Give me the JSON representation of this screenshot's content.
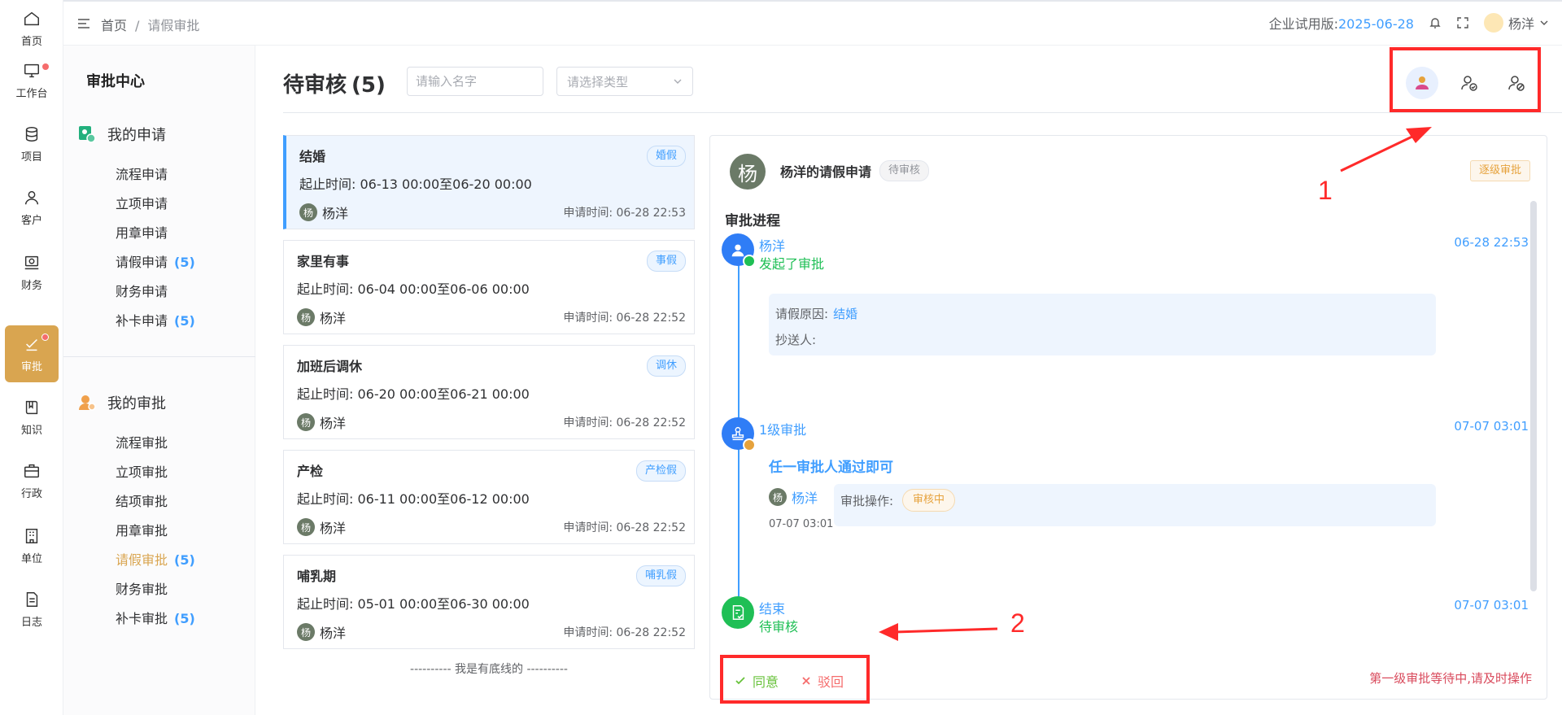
{
  "rail": {
    "items": [
      {
        "label": "首页",
        "icon": "home-icon"
      },
      {
        "label": "工作台",
        "icon": "monitor-icon",
        "dot": true
      },
      {
        "label": "项目",
        "icon": "database-icon"
      },
      {
        "label": "客户",
        "icon": "user-icon"
      },
      {
        "label": "财务",
        "icon": "finance-icon"
      },
      {
        "label": "审批",
        "icon": "approve-icon",
        "active": true,
        "dot": true
      },
      {
        "label": "知识",
        "icon": "book-icon"
      },
      {
        "label": "行政",
        "icon": "briefcase-icon"
      },
      {
        "label": "单位",
        "icon": "building-icon"
      },
      {
        "label": "日志",
        "icon": "log-icon"
      }
    ]
  },
  "header": {
    "breadcrumb": {
      "home": "首页",
      "sep": "/",
      "current": "请假审批"
    },
    "edition_label": "企业试用版:",
    "edition_date": "2025-06-28",
    "user_name": "杨洋"
  },
  "sidebar": {
    "title": "审批中心",
    "my_apply": {
      "title": "我的申请",
      "items": [
        {
          "label": "流程申请",
          "count": ""
        },
        {
          "label": "立项申请",
          "count": ""
        },
        {
          "label": "用章申请",
          "count": ""
        },
        {
          "label": "请假申请",
          "count": "(5)"
        },
        {
          "label": "财务申请",
          "count": ""
        },
        {
          "label": "补卡申请",
          "count": "(5)"
        }
      ]
    },
    "my_approve": {
      "title": "我的审批",
      "items": [
        {
          "label": "流程审批",
          "count": ""
        },
        {
          "label": "立项审批",
          "count": ""
        },
        {
          "label": "结项审批",
          "count": ""
        },
        {
          "label": "用章审批",
          "count": ""
        },
        {
          "label": "请假审批",
          "count": "(5)",
          "active": true
        },
        {
          "label": "财务审批",
          "count": ""
        },
        {
          "label": "补卡审批",
          "count": "(5)"
        }
      ]
    }
  },
  "main": {
    "title": "待审核",
    "count": "(5)",
    "search_placeholder": "请输入名字",
    "type_placeholder": "请选择类型",
    "colors": {
      "accent": "#409eff",
      "active_nav": "#d9a550",
      "annotation": "#ff2a2a"
    }
  },
  "cards": [
    {
      "title": "结婚",
      "tag": "婚假",
      "time": "起止时间:  06-13 00:00至06-20 00:00",
      "avatar": "杨",
      "user": "杨洋",
      "apply": "申请时间:  06-28 22:53",
      "active": true
    },
    {
      "title": "家里有事",
      "tag": "事假",
      "time": "起止时间:  06-04 00:00至06-06 00:00",
      "avatar": "杨",
      "user": "杨洋",
      "apply": "申请时间:  06-28 22:52"
    },
    {
      "title": "加班后调休",
      "tag": "调休",
      "time": "起止时间:  06-20 00:00至06-21 00:00",
      "avatar": "杨",
      "user": "杨洋",
      "apply": "申请时间:  06-28 22:52"
    },
    {
      "title": "产检",
      "tag": "产检假",
      "time": "起止时间:  06-11 00:00至06-12 00:00",
      "avatar": "杨",
      "user": "杨洋",
      "apply": "申请时间:  06-28 22:52"
    },
    {
      "title": "哺乳期",
      "tag": "哺乳假",
      "time": "起止时间:  05-01 00:00至06-30 00:00",
      "avatar": "杨",
      "user": "杨洋",
      "apply": "申请时间:  06-28 22:52"
    }
  ],
  "list_footer": "---------- 我是有底线的 ----------",
  "detail": {
    "avatar": "杨",
    "title": "杨洋的请假申请",
    "status": "待审核",
    "mode": "逐级审批",
    "progress_title": "审批进程",
    "start": {
      "name": "杨洋",
      "time": "06-28 22:53",
      "action": "发起了审批"
    },
    "reason_label": "请假原因:",
    "reason_value": "结婚",
    "cc_label": "抄送人:",
    "level1": {
      "name": "1级审批",
      "time": "07-07 03:01",
      "rule": "任一审批人通过即可"
    },
    "approver": {
      "avatar": "杨",
      "name": "杨洋",
      "time": "07-07 03:01",
      "op_label": "审批操作:",
      "op_status": "审核中"
    },
    "end": {
      "name": "结束",
      "time": "07-07 03:01",
      "status": "待审核"
    },
    "agree_label": "同意",
    "reject_label": "驳回",
    "hint": "第一级审批等待中,请及时操作"
  },
  "annotations": {
    "one": "1",
    "two": "2"
  }
}
